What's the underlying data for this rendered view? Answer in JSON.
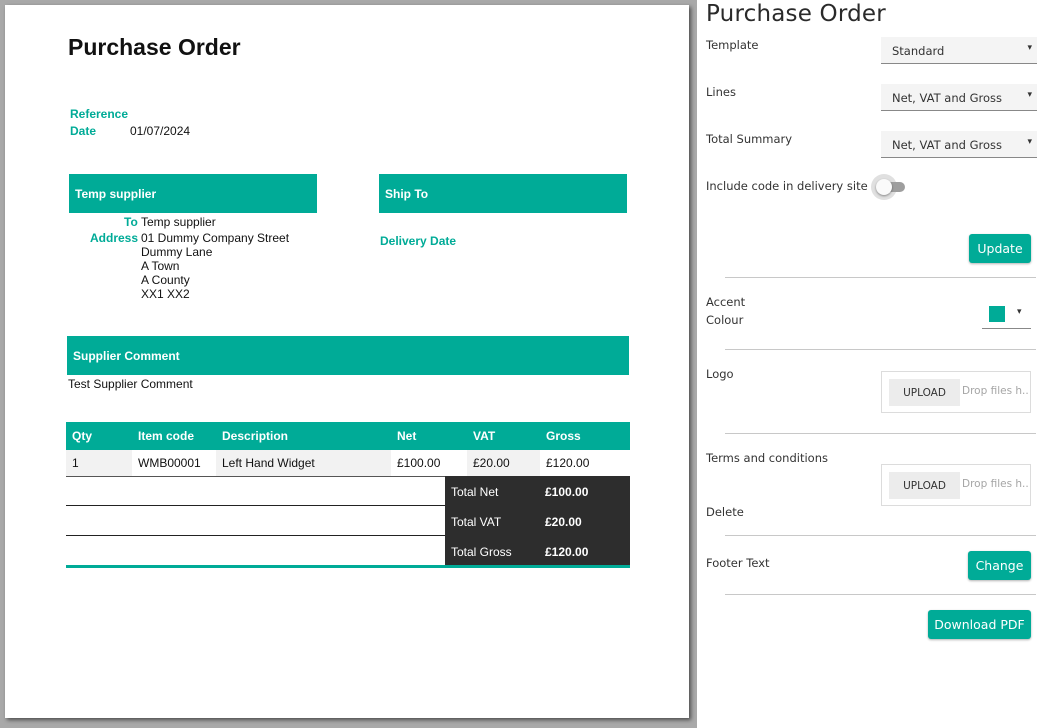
{
  "document": {
    "title": "Purchase Order",
    "reference_label": "Reference",
    "reference_value": "",
    "date_label": "Date",
    "date_value": "01/07/2024",
    "supplier_header": "Temp supplier",
    "ship_to_header": "Ship To",
    "to_label": "To",
    "to_value": "Temp supplier",
    "address_label": "Address",
    "address_lines": [
      "01 Dummy Company Street",
      "Dummy Lane",
      "A Town",
      "A County",
      "XX1 XX2"
    ],
    "delivery_date_label": "Delivery Date",
    "supplier_comment_header": "Supplier Comment",
    "supplier_comment": "Test Supplier Comment",
    "table": {
      "columns": [
        "Qty",
        "Item code",
        "Description",
        "Net",
        "VAT",
        "Gross"
      ],
      "rows": [
        [
          "1",
          "WMB00001",
          "Left Hand Widget",
          "£100.00",
          "£20.00",
          "£120.00"
        ]
      ]
    },
    "totals": [
      {
        "label": "Total Net",
        "value": "£100.00"
      },
      {
        "label": "Total VAT",
        "value": "£20.00"
      },
      {
        "label": "Total Gross",
        "value": "£120.00"
      }
    ],
    "accent_color": "#00ab97",
    "totals_bg_color": "#2d2d2d"
  },
  "panel": {
    "title": "Purchase Order",
    "template_label": "Template",
    "template_value": "Standard",
    "lines_label": "Lines",
    "lines_value": "Net, VAT and Gross",
    "total_summary_label": "Total Summary",
    "total_summary_value": "Net, VAT and Gross",
    "include_code_label": "Include code in delivery site",
    "include_code_on": false,
    "update_button": "Update",
    "accent_label_1": "Accent",
    "accent_label_2": "Colour",
    "accent_color": "#00ab97",
    "logo_label": "Logo",
    "upload_button": "UPLOAD",
    "drop_text": "Drop files h...",
    "terms_label": "Terms and conditions",
    "delete_label": "Delete",
    "footer_label": "Footer Text",
    "change_button": "Change",
    "download_button": "Download PDF",
    "caret_icon": "▾"
  }
}
